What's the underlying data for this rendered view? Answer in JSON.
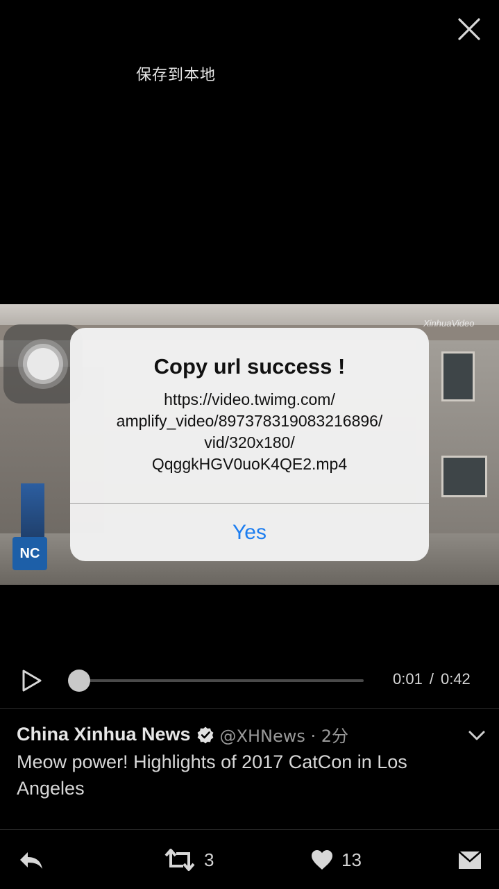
{
  "top": {
    "close_icon": "close-icon",
    "save_local_label": "保存到本地"
  },
  "alert": {
    "title": "Copy url success !",
    "message_lines": [
      "https://video.twimg.com/",
      "amplify_video/897378319083216896/",
      "vid/320x180/",
      "QqggkHGV0uoK4QE2.mp4"
    ],
    "button_label": "Yes",
    "button_color": "#1c7df0"
  },
  "player": {
    "current_time": "0:01",
    "separator": "/",
    "duration": "0:42",
    "progress": 0.024
  },
  "tweet": {
    "author_name": "China Xinhua News",
    "handle_time": "@XHNews · 2分",
    "text": "Meow power! Highlights of 2017 CatCon in Los Angeles"
  },
  "actions": {
    "reply_icon": "reply-icon",
    "retweet_count": "3",
    "like_count": "13",
    "dm_icon": "direct-message-icon"
  }
}
